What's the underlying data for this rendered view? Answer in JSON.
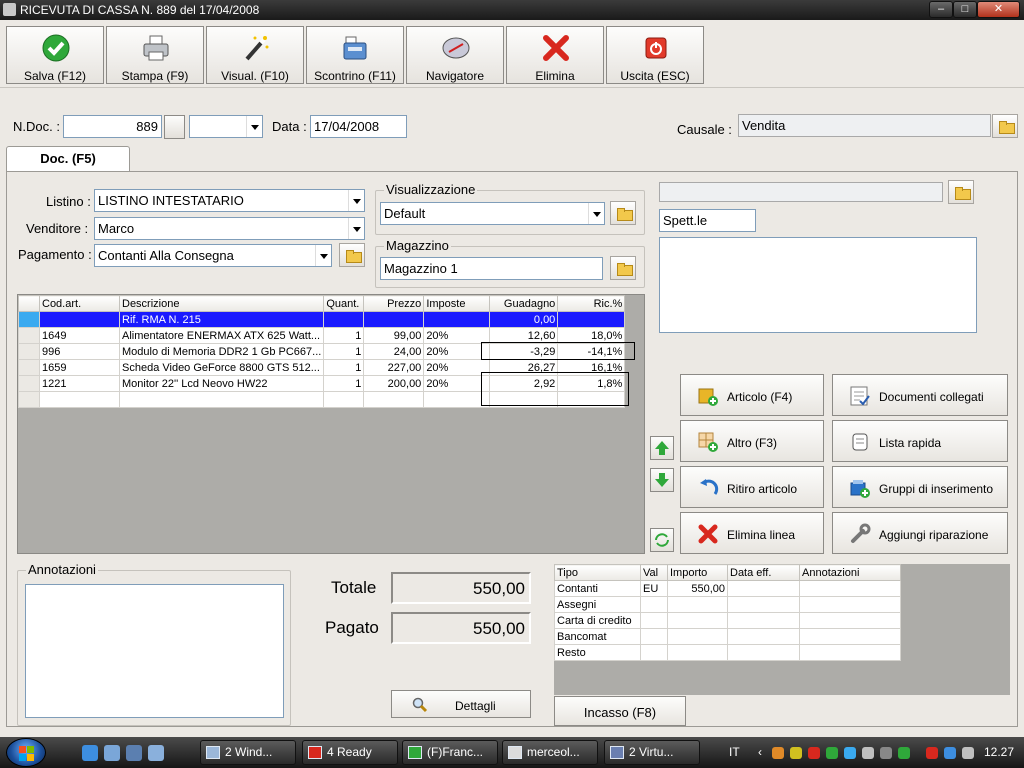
{
  "window": {
    "title": "RICEVUTA DI CASSA N. 889  del 17/04/2008"
  },
  "toolbar": {
    "save": "Salva (F12)",
    "print": "Stampa (F9)",
    "view": "Visual. (F10)",
    "receipt": "Scontrino (F11)",
    "navigator": "Navigatore",
    "delete": "Elimina",
    "exit": "Uscita (ESC)"
  },
  "header": {
    "ndoc_label": "N.Doc. :",
    "ndoc_value": "889",
    "data_label": "Data :",
    "data_value": "17/04/2008",
    "causale_label": "Causale :",
    "causale_value": "Vendita"
  },
  "tab": {
    "doc": "Doc. (F5)"
  },
  "form": {
    "listino_label": "Listino :",
    "listino_value": "LISTINO INTESTATARIO",
    "venditore_label": "Venditore :",
    "venditore_value": "Marco",
    "pagamento_label": "Pagamento :",
    "pagamento_value": "Contanti Alla Consegna",
    "visual_title": "Visualizzazione",
    "visual_value": "Default",
    "magazzino_title": "Magazzino",
    "magazzino_value": "Magazzino 1",
    "cliente_value": "",
    "spett_value": "Spett.le"
  },
  "grid": {
    "columns": [
      "Cod.art.",
      "Descrizione",
      "Quant.",
      "Prezzo",
      "Imposte",
      "Guadagno",
      "Ric.%"
    ],
    "rows": [
      [
        "",
        "Rif. RMA N. 215",
        "",
        "",
        "",
        "0,00",
        ""
      ],
      [
        "1649",
        "Alimentatore ENERMAX ATX 625 Watt...",
        "1",
        "99,00",
        "20%",
        "12,60",
        "18,0%"
      ],
      [
        "996",
        "Modulo di Memoria DDR2 1 Gb PC667...",
        "1",
        "24,00",
        "20%",
        "-3,29",
        "-14,1%"
      ],
      [
        "1659",
        "Scheda Video GeForce 8800 GTS 512...",
        "1",
        "227,00",
        "20%",
        "26,27",
        "16,1%"
      ],
      [
        "1221",
        "Monitor 22'' Lcd Neovo HW22",
        "1",
        "200,00",
        "20%",
        "2,92",
        "1,8%"
      ],
      [
        "",
        "",
        "",
        "",
        "",
        "",
        ""
      ]
    ]
  },
  "actions": {
    "articolo": "Articolo (F4)",
    "documenti": "Documenti collegati",
    "altro": "Altro (F3)",
    "lista": "Lista rapida",
    "ritiro": "Ritiro articolo",
    "gruppi": "Gruppi di inserimento",
    "elimina_linea": "Elimina linea",
    "riparazione": "Aggiungi riparazione"
  },
  "notes": {
    "title": "Annotazioni",
    "value": ""
  },
  "totals": {
    "totale_label": "Totale",
    "totale_value": "550,00",
    "pagato_label": "Pagato",
    "pagato_value": "550,00",
    "dettagli": "Dettagli"
  },
  "payments": {
    "columns": [
      "Tipo",
      "Val",
      "Importo",
      "Data eff.",
      "Annotazioni"
    ],
    "rows": [
      [
        "Contanti",
        "EU",
        "550,00",
        "",
        ""
      ],
      [
        "Assegni",
        "",
        "",
        "",
        ""
      ],
      [
        "Carta di credito",
        "",
        "",
        "",
        ""
      ],
      [
        "Bancomat",
        "",
        "",
        "",
        ""
      ],
      [
        "Resto",
        "",
        "",
        "",
        ""
      ]
    ]
  },
  "incasso": "Incasso (F8)",
  "taskbar": {
    "tasks": [
      "2 Wind...",
      "4 Ready",
      "(F)Franc...",
      "merceol...",
      "2 Virtu..."
    ],
    "lang": "IT",
    "clock": "12.27"
  },
  "colors": {
    "selected_row": "#1a1aff",
    "accent": "#3aaaf0"
  }
}
